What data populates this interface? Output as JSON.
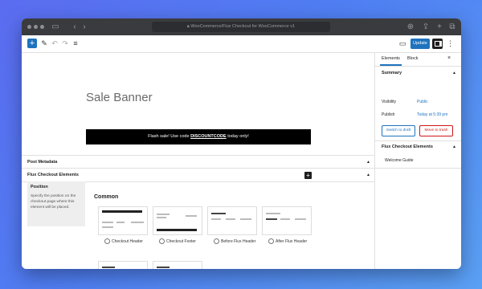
{
  "browser": {
    "url": "WooCommerce/Flux Checkout for WooCommerce v1"
  },
  "toolbar": {
    "update_label": "Update"
  },
  "editor": {
    "title": "Sale Banner",
    "banner": {
      "prefix": "Flash sale! Use code ",
      "code": "DISCOUNTCODE",
      "suffix": " today only!"
    },
    "sections": {
      "post_metadata": "Post Metadata",
      "flux_elements": "Flux Checkout Elements"
    },
    "position": {
      "title": "Position",
      "description": "Specify the position on the checkout page where this element will be placed."
    },
    "common_heading": "Common",
    "cards": [
      {
        "label": "Checkout Header"
      },
      {
        "label": "Checkout Footer"
      },
      {
        "label": "Before Flux Header"
      },
      {
        "label": "After Flux Header"
      },
      {
        "label": ""
      },
      {
        "label": ""
      }
    ]
  },
  "sidebar": {
    "tabs": [
      "Elements",
      "Block"
    ],
    "summary_heading": "Summary",
    "visibility_label": "Visibility",
    "visibility_value": "Public",
    "publish_label": "Publish",
    "publish_value": "Today at 5:39 pm",
    "switch_draft": "Switch to draft",
    "move_trash": "Move to trash",
    "flux_heading": "Flux Checkout Elements",
    "welcome_guide": "Welcome Guide"
  },
  "colors": {
    "accent": "#1e73be",
    "danger": "#cc1818"
  }
}
